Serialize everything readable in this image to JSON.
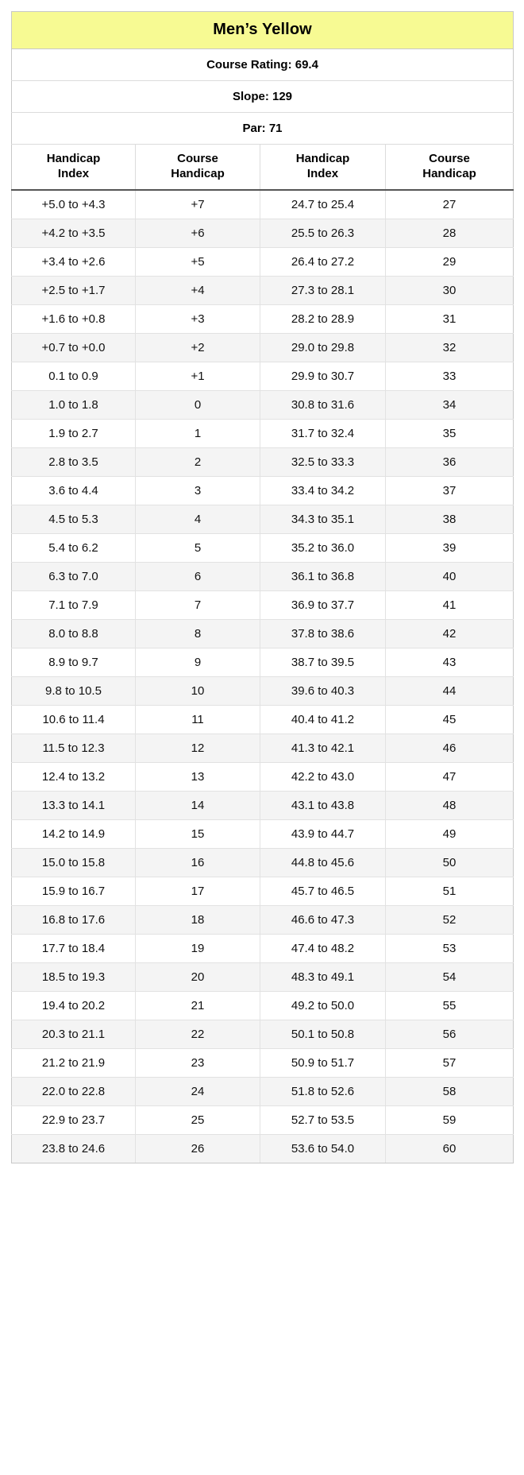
{
  "table": {
    "banner_title": "Men’s Yellow",
    "meta": [
      "Course Rating: 69.4",
      "Slope: 129",
      "Par: 71"
    ],
    "course_rating_label": "Course Rating",
    "course_rating_value": "69.4",
    "slope_label": "Slope",
    "slope_value": "129",
    "par_label": "Par",
    "par_value": "71",
    "colors": {
      "banner_background": "#f7fa93",
      "row_stripe": "#f4f4f4",
      "row_base": "#ffffff",
      "grid_line": "#e2e2e2",
      "header_rule": "#555555",
      "text": "#111111"
    },
    "headers": [
      {
        "line1": "Handicap",
        "line2": "Index"
      },
      {
        "line1": "Course",
        "line2": "Handicap"
      },
      {
        "line1": "Handicap",
        "line2": "Index"
      },
      {
        "line1": "Course",
        "line2": "Handicap"
      }
    ],
    "rows": [
      [
        "+5.0 to +4.3",
        "+7",
        "24.7 to 25.4",
        "27"
      ],
      [
        "+4.2 to +3.5",
        "+6",
        "25.5 to 26.3",
        "28"
      ],
      [
        "+3.4 to +2.6",
        "+5",
        "26.4 to 27.2",
        "29"
      ],
      [
        "+2.5 to +1.7",
        "+4",
        "27.3 to 28.1",
        "30"
      ],
      [
        "+1.6 to +0.8",
        "+3",
        "28.2 to 28.9",
        "31"
      ],
      [
        "+0.7 to +0.0",
        "+2",
        "29.0 to 29.8",
        "32"
      ],
      [
        "0.1 to 0.9",
        "+1",
        "29.9 to 30.7",
        "33"
      ],
      [
        "1.0 to 1.8",
        "0",
        "30.8 to 31.6",
        "34"
      ],
      [
        "1.9 to 2.7",
        "1",
        "31.7 to 32.4",
        "35"
      ],
      [
        "2.8 to 3.5",
        "2",
        "32.5 to 33.3",
        "36"
      ],
      [
        "3.6 to 4.4",
        "3",
        "33.4 to 34.2",
        "37"
      ],
      [
        "4.5 to 5.3",
        "4",
        "34.3 to 35.1",
        "38"
      ],
      [
        "5.4 to 6.2",
        "5",
        "35.2 to 36.0",
        "39"
      ],
      [
        "6.3 to 7.0",
        "6",
        "36.1 to 36.8",
        "40"
      ],
      [
        "7.1 to 7.9",
        "7",
        "36.9 to 37.7",
        "41"
      ],
      [
        "8.0 to 8.8",
        "8",
        "37.8 to 38.6",
        "42"
      ],
      [
        "8.9 to 9.7",
        "9",
        "38.7 to 39.5",
        "43"
      ],
      [
        "9.8 to 10.5",
        "10",
        "39.6 to 40.3",
        "44"
      ],
      [
        "10.6 to 11.4",
        "11",
        "40.4 to 41.2",
        "45"
      ],
      [
        "11.5 to 12.3",
        "12",
        "41.3 to 42.1",
        "46"
      ],
      [
        "12.4 to 13.2",
        "13",
        "42.2 to 43.0",
        "47"
      ],
      [
        "13.3 to 14.1",
        "14",
        "43.1 to 43.8",
        "48"
      ],
      [
        "14.2 to 14.9",
        "15",
        "43.9 to 44.7",
        "49"
      ],
      [
        "15.0 to 15.8",
        "16",
        "44.8 to 45.6",
        "50"
      ],
      [
        "15.9 to 16.7",
        "17",
        "45.7 to 46.5",
        "51"
      ],
      [
        "16.8 to 17.6",
        "18",
        "46.6 to 47.3",
        "52"
      ],
      [
        "17.7 to 18.4",
        "19",
        "47.4 to 48.2",
        "53"
      ],
      [
        "18.5 to 19.3",
        "20",
        "48.3 to 49.1",
        "54"
      ],
      [
        "19.4 to 20.2",
        "21",
        "49.2 to 50.0",
        "55"
      ],
      [
        "20.3 to 21.1",
        "22",
        "50.1 to 50.8",
        "56"
      ],
      [
        "21.2 to 21.9",
        "23",
        "50.9 to 51.7",
        "57"
      ],
      [
        "22.0 to 22.8",
        "24",
        "51.8 to 52.6",
        "58"
      ],
      [
        "22.9 to 23.7",
        "25",
        "52.7 to 53.5",
        "59"
      ],
      [
        "23.8 to 24.6",
        "26",
        "53.6 to 54.0",
        "60"
      ]
    ]
  }
}
